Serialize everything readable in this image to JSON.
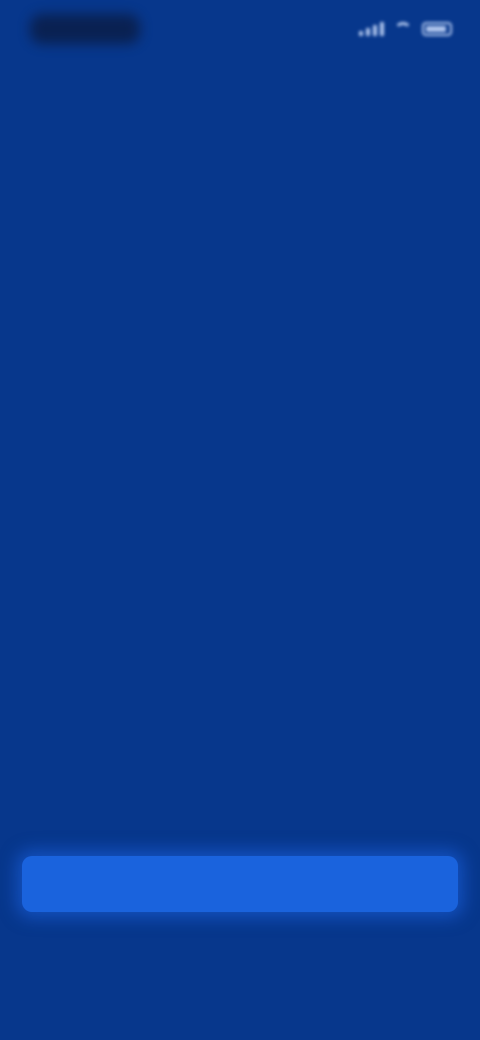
{
  "app": {
    "background_color": "#07378c",
    "accent_color": "#1a63dd"
  },
  "status_bar": {
    "icons": [
      "signal-icon",
      "wifi-icon",
      "battery-icon"
    ]
  },
  "header": {
    "title": ""
  },
  "content": {
    "heading": "",
    "paragraph_lines": [
      "",
      "",
      "",
      "",
      ""
    ],
    "info_line_1": "",
    "info_line_2": ""
  },
  "actions": {
    "primary_label": "",
    "secondary_label": ""
  }
}
